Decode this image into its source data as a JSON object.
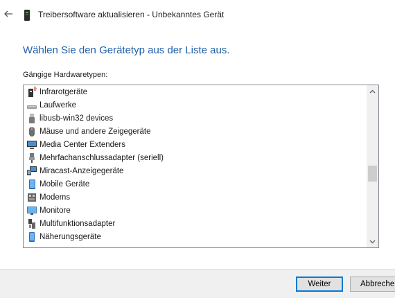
{
  "header": {
    "title": "Treibersoftware aktualisieren - Unbekanntes Gerät",
    "back_icon": "back-arrow-icon",
    "device_icon": "device-icon"
  },
  "main": {
    "heading": "Wählen Sie den Gerätetyp aus der Liste aus.",
    "list_label": "Gängige Hardwaretypen:",
    "items": [
      {
        "label": "Infrarotgeräte",
        "icon": "infrared-icon"
      },
      {
        "label": "Laufwerke",
        "icon": "drive-icon"
      },
      {
        "label": "libusb-win32 devices",
        "icon": "usb-icon"
      },
      {
        "label": "Mäuse und andere Zeigegeräte",
        "icon": "mouse-icon"
      },
      {
        "label": "Media Center Extenders",
        "icon": "monitor-icon"
      },
      {
        "label": "Mehrfachanschlussadapter (seriell)",
        "icon": "serial-adapter-icon"
      },
      {
        "label": "Miracast-Anzeigegeräte",
        "icon": "miracast-icon"
      },
      {
        "label": "Mobile Geräte",
        "icon": "mobile-device-icon"
      },
      {
        "label": "Modems",
        "icon": "modem-icon"
      },
      {
        "label": "Monitore",
        "icon": "monitor-icon"
      },
      {
        "label": "Multifunktionsadapter",
        "icon": "multifunction-adapter-icon"
      },
      {
        "label": "Näherungsgeräte",
        "icon": "proximity-device-icon"
      }
    ],
    "scroll_position": 0.5
  },
  "footer": {
    "next_label": "Weiter",
    "cancel_label": "Abbreche"
  },
  "colors": {
    "heading": "#1f5fa8",
    "primary_border": "#0078d7",
    "footer_bg": "#f0f0f0"
  }
}
